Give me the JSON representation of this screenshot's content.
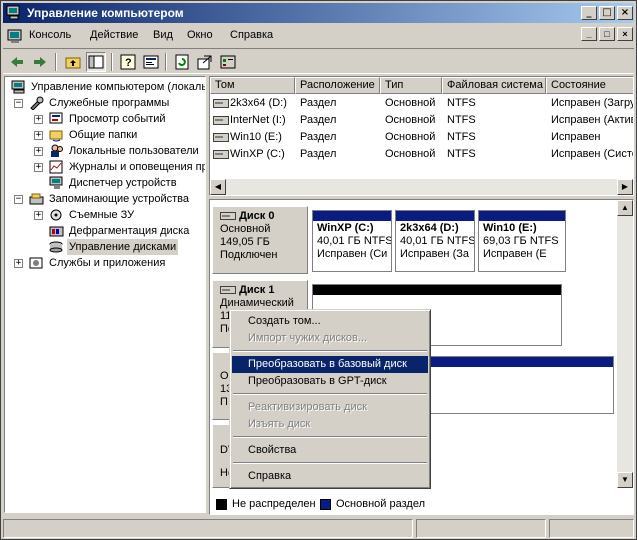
{
  "window": {
    "title": "Управление компьютером",
    "buttons": [
      "_",
      "□",
      "×"
    ]
  },
  "menubar": {
    "items": [
      "Консоль",
      "Действие",
      "Вид",
      "Окно",
      "Справка"
    ],
    "child_buttons": [
      "_",
      "□",
      "×"
    ]
  },
  "toolbar": {
    "icons": [
      "back-icon",
      "forward-icon",
      "up-folder-icon",
      "show-tree-icon",
      "help-icon",
      "properties-icon",
      "refresh-icon",
      "export-icon",
      "settings-icon"
    ]
  },
  "tree": {
    "root": "Управление компьютером (локаль",
    "items": [
      {
        "label": "Служебные программы",
        "level": 1,
        "expander": "−"
      },
      {
        "label": "Просмотр событий",
        "level": 2,
        "expander": "+"
      },
      {
        "label": "Общие папки",
        "level": 2,
        "expander": "+"
      },
      {
        "label": "Локальные пользователи",
        "level": 2,
        "expander": "+"
      },
      {
        "label": "Журналы и оповещения пр",
        "level": 2,
        "expander": "+"
      },
      {
        "label": "Диспетчер устройств",
        "level": 2,
        "expander": ""
      },
      {
        "label": "Запоминающие устройства",
        "level": 1,
        "expander": "−"
      },
      {
        "label": "Съемные ЗУ",
        "level": 2,
        "expander": "+"
      },
      {
        "label": "Дефрагментация диска",
        "level": 2,
        "expander": ""
      },
      {
        "label": "Управление дисками",
        "level": 2,
        "expander": ""
      },
      {
        "label": "Службы и приложения",
        "level": 1,
        "expander": "+"
      }
    ]
  },
  "volumes": {
    "columns": [
      "Том",
      "Расположение",
      "Тип",
      "Файловая система",
      "Состояние"
    ],
    "rows": [
      {
        "name": "2k3x64 (D:)",
        "location": "Раздел",
        "type": "Основной",
        "fs": "NTFS",
        "status": "Исправен (Загру"
      },
      {
        "name": "InterNet (I:)",
        "location": "Раздел",
        "type": "Основной",
        "fs": "NTFS",
        "status": "Исправен (Актив"
      },
      {
        "name": "Win10 (E:)",
        "location": "Раздел",
        "type": "Основной",
        "fs": "NTFS",
        "status": "Исправен"
      },
      {
        "name": "WinXP (C:)",
        "location": "Раздел",
        "type": "Основной",
        "fs": "NTFS",
        "status": "Исправен (Систе"
      }
    ]
  },
  "disks": {
    "disk0": {
      "name": "Диск 0",
      "type": "Основной",
      "size": "149,05 ГБ",
      "state": "Подключен",
      "partitions": [
        {
          "title": "WinXP  (C:)",
          "size": "40,01 ГБ NTFS",
          "status": "Исправен (Си"
        },
        {
          "title": "2k3x64  (D:)",
          "size": "40,01 ГБ NTFS",
          "status": "Исправен (За"
        },
        {
          "title": "Win10  (E:)",
          "size": "69,03 ГБ NTFS",
          "status": "Исправен (E"
        }
      ]
    },
    "disk1": {
      "name": "Диск 1",
      "type": "Динамический",
      "size_partial": "11",
      "state_partial": "По"
    },
    "disk2": {
      "line1": "О",
      "line2": "13",
      "line3": "П"
    },
    "disk3": {
      "line1": "DV",
      "line2": "Не"
    }
  },
  "legend": {
    "unallocated": "Не распределен",
    "primary": "Основной раздел"
  },
  "context_menu": {
    "items": [
      {
        "label": "Создать том...",
        "state": "normal"
      },
      {
        "label": "Импорт чужих дисков...",
        "state": "disabled"
      },
      {
        "label": "Преобразовать в базовый диск",
        "state": "highlighted"
      },
      {
        "label": "Преобразовать в GPT-диск",
        "state": "normal"
      },
      {
        "label": "Реактивизировать диск",
        "state": "disabled"
      },
      {
        "label": "Изъять диск",
        "state": "disabled"
      },
      {
        "label": "Свойства",
        "state": "normal"
      },
      {
        "label": "Справка",
        "state": "normal"
      }
    ]
  },
  "colors": {
    "title_start": "#0a246a",
    "title_end": "#a6caf0",
    "primary_partition": "#0a1c82",
    "unallocated": "#000000",
    "face": "#d4d0c8"
  }
}
